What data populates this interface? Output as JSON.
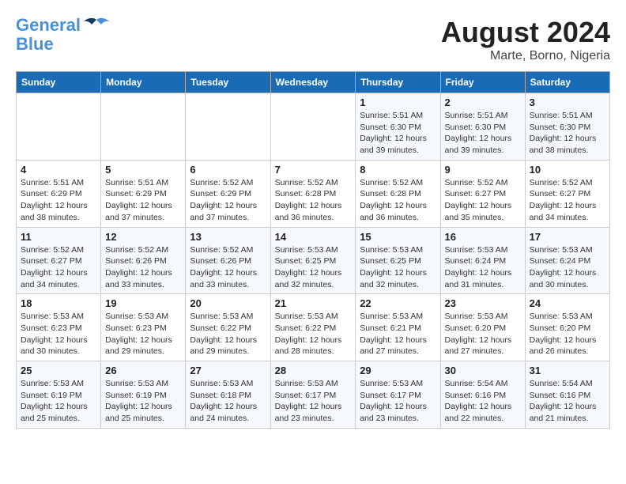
{
  "header": {
    "logo_line1": "General",
    "logo_line2": "Blue",
    "month_year": "August 2024",
    "location": "Marte, Borno, Nigeria"
  },
  "weekdays": [
    "Sunday",
    "Monday",
    "Tuesday",
    "Wednesday",
    "Thursday",
    "Friday",
    "Saturday"
  ],
  "weeks": [
    [
      {
        "day": "",
        "info": ""
      },
      {
        "day": "",
        "info": ""
      },
      {
        "day": "",
        "info": ""
      },
      {
        "day": "",
        "info": ""
      },
      {
        "day": "1",
        "info": "Sunrise: 5:51 AM\nSunset: 6:30 PM\nDaylight: 12 hours\nand 39 minutes."
      },
      {
        "day": "2",
        "info": "Sunrise: 5:51 AM\nSunset: 6:30 PM\nDaylight: 12 hours\nand 39 minutes."
      },
      {
        "day": "3",
        "info": "Sunrise: 5:51 AM\nSunset: 6:30 PM\nDaylight: 12 hours\nand 38 minutes."
      }
    ],
    [
      {
        "day": "4",
        "info": "Sunrise: 5:51 AM\nSunset: 6:29 PM\nDaylight: 12 hours\nand 38 minutes."
      },
      {
        "day": "5",
        "info": "Sunrise: 5:51 AM\nSunset: 6:29 PM\nDaylight: 12 hours\nand 37 minutes."
      },
      {
        "day": "6",
        "info": "Sunrise: 5:52 AM\nSunset: 6:29 PM\nDaylight: 12 hours\nand 37 minutes."
      },
      {
        "day": "7",
        "info": "Sunrise: 5:52 AM\nSunset: 6:28 PM\nDaylight: 12 hours\nand 36 minutes."
      },
      {
        "day": "8",
        "info": "Sunrise: 5:52 AM\nSunset: 6:28 PM\nDaylight: 12 hours\nand 36 minutes."
      },
      {
        "day": "9",
        "info": "Sunrise: 5:52 AM\nSunset: 6:27 PM\nDaylight: 12 hours\nand 35 minutes."
      },
      {
        "day": "10",
        "info": "Sunrise: 5:52 AM\nSunset: 6:27 PM\nDaylight: 12 hours\nand 34 minutes."
      }
    ],
    [
      {
        "day": "11",
        "info": "Sunrise: 5:52 AM\nSunset: 6:27 PM\nDaylight: 12 hours\nand 34 minutes."
      },
      {
        "day": "12",
        "info": "Sunrise: 5:52 AM\nSunset: 6:26 PM\nDaylight: 12 hours\nand 33 minutes."
      },
      {
        "day": "13",
        "info": "Sunrise: 5:52 AM\nSunset: 6:26 PM\nDaylight: 12 hours\nand 33 minutes."
      },
      {
        "day": "14",
        "info": "Sunrise: 5:53 AM\nSunset: 6:25 PM\nDaylight: 12 hours\nand 32 minutes."
      },
      {
        "day": "15",
        "info": "Sunrise: 5:53 AM\nSunset: 6:25 PM\nDaylight: 12 hours\nand 32 minutes."
      },
      {
        "day": "16",
        "info": "Sunrise: 5:53 AM\nSunset: 6:24 PM\nDaylight: 12 hours\nand 31 minutes."
      },
      {
        "day": "17",
        "info": "Sunrise: 5:53 AM\nSunset: 6:24 PM\nDaylight: 12 hours\nand 30 minutes."
      }
    ],
    [
      {
        "day": "18",
        "info": "Sunrise: 5:53 AM\nSunset: 6:23 PM\nDaylight: 12 hours\nand 30 minutes."
      },
      {
        "day": "19",
        "info": "Sunrise: 5:53 AM\nSunset: 6:23 PM\nDaylight: 12 hours\nand 29 minutes."
      },
      {
        "day": "20",
        "info": "Sunrise: 5:53 AM\nSunset: 6:22 PM\nDaylight: 12 hours\nand 29 minutes."
      },
      {
        "day": "21",
        "info": "Sunrise: 5:53 AM\nSunset: 6:22 PM\nDaylight: 12 hours\nand 28 minutes."
      },
      {
        "day": "22",
        "info": "Sunrise: 5:53 AM\nSunset: 6:21 PM\nDaylight: 12 hours\nand 27 minutes."
      },
      {
        "day": "23",
        "info": "Sunrise: 5:53 AM\nSunset: 6:20 PM\nDaylight: 12 hours\nand 27 minutes."
      },
      {
        "day": "24",
        "info": "Sunrise: 5:53 AM\nSunset: 6:20 PM\nDaylight: 12 hours\nand 26 minutes."
      }
    ],
    [
      {
        "day": "25",
        "info": "Sunrise: 5:53 AM\nSunset: 6:19 PM\nDaylight: 12 hours\nand 25 minutes."
      },
      {
        "day": "26",
        "info": "Sunrise: 5:53 AM\nSunset: 6:19 PM\nDaylight: 12 hours\nand 25 minutes."
      },
      {
        "day": "27",
        "info": "Sunrise: 5:53 AM\nSunset: 6:18 PM\nDaylight: 12 hours\nand 24 minutes."
      },
      {
        "day": "28",
        "info": "Sunrise: 5:53 AM\nSunset: 6:17 PM\nDaylight: 12 hours\nand 23 minutes."
      },
      {
        "day": "29",
        "info": "Sunrise: 5:53 AM\nSunset: 6:17 PM\nDaylight: 12 hours\nand 23 minutes."
      },
      {
        "day": "30",
        "info": "Sunrise: 5:54 AM\nSunset: 6:16 PM\nDaylight: 12 hours\nand 22 minutes."
      },
      {
        "day": "31",
        "info": "Sunrise: 5:54 AM\nSunset: 6:16 PM\nDaylight: 12 hours\nand 21 minutes."
      }
    ]
  ]
}
